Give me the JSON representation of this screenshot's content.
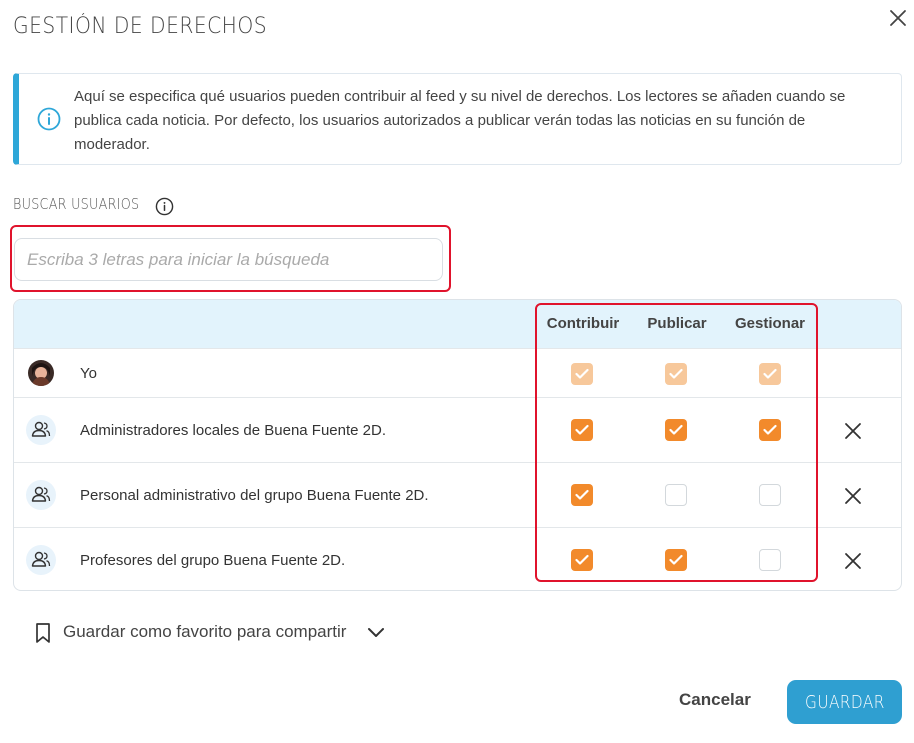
{
  "dialog": {
    "title": "GESTIÓN DE DERECHOS",
    "info_text": "Aquí se especifica qué usuarios pueden contribuir al feed y su nivel de derechos. Los lectores se añaden cuando se publica cada noticia. Por defecto, los usuarios autorizados a publicar verán todas las noticias en su función de moderador."
  },
  "search": {
    "label": "BUSCAR USUARIOS",
    "placeholder": "Escriba 3 letras para iniciar la búsqueda",
    "value": ""
  },
  "table": {
    "columns": [
      "Contribuir",
      "Publicar",
      "Gestionar"
    ],
    "rows": [
      {
        "name": "Yo",
        "icon": "user-avatar",
        "rights": [
          "disabled-checked",
          "disabled-checked",
          "disabled-checked"
        ],
        "removable": false
      },
      {
        "name": "Administradores locales de Buena Fuente 2D.",
        "icon": "users-group-icon",
        "rights": [
          "checked",
          "checked",
          "checked"
        ],
        "removable": true
      },
      {
        "name": "Personal administrativo del grupo Buena Fuente 2D.",
        "icon": "users-group-icon",
        "rights": [
          "checked",
          "unchecked",
          "unchecked"
        ],
        "removable": true
      },
      {
        "name": "Profesores del grupo Buena Fuente 2D.",
        "icon": "users-group-icon",
        "rights": [
          "checked",
          "checked",
          "unchecked"
        ],
        "removable": true
      }
    ]
  },
  "favorite": {
    "label": "Guardar como favorito para compartir"
  },
  "footer": {
    "cancel": "Cancelar",
    "save": "GUARDAR"
  },
  "colors": {
    "accent": "#2f9fd1",
    "checkbox_on": "#f28a2b",
    "checkbox_disabled": "#f7c89b",
    "header_bg": "#e2f3fc",
    "highlight": "#e0132c"
  }
}
